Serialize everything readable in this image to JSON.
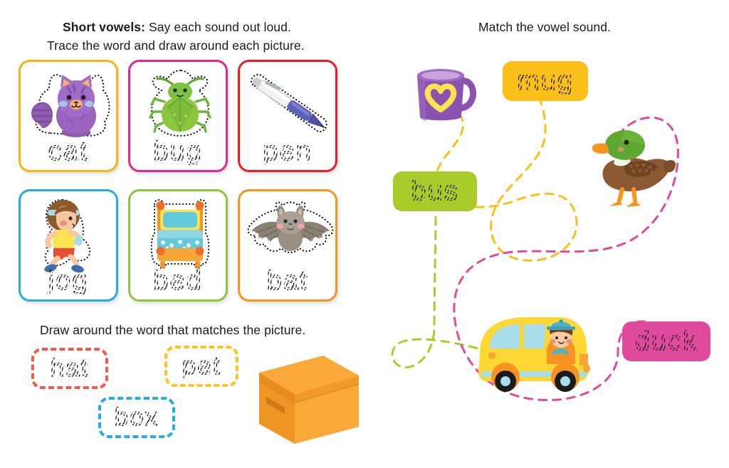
{
  "left": {
    "heading_bold": "Short vowels:",
    "heading_rest": " Say each sound out loud.",
    "heading_line2": "Trace the word and draw around each picture.",
    "cards": [
      {
        "word": "cat",
        "border": "#F5B513",
        "art": "cat-illustration"
      },
      {
        "word": "bug",
        "border": "#E5268F",
        "art": "bug-illustration"
      },
      {
        "word": "pen",
        "border": "#ED1C24",
        "art": "pen-illustration"
      },
      {
        "word": "jog",
        "border": "#29ABE2",
        "art": "jogger-illustration"
      },
      {
        "word": "bed",
        "border": "#8CC63F",
        "art": "bed-illustration"
      },
      {
        "word": "bat",
        "border": "#F7941E",
        "art": "bat-illustration"
      }
    ],
    "subheading": "Draw around the word that matches the picture.",
    "word_choices": [
      {
        "word": "hat",
        "border": "#F15A4A"
      },
      {
        "word": "pet",
        "border": "#FDC41F"
      },
      {
        "word": "box",
        "border": "#29ABE2"
      }
    ],
    "picture": "orange-box-illustration"
  },
  "right": {
    "heading": "Match the vowel sound.",
    "pictures": [
      {
        "name": "purple-mug-illustration",
        "label": "mug-picture"
      },
      {
        "name": "mallard-duck-illustration",
        "label": "duck-picture"
      },
      {
        "name": "yellow-school-bus-illustration",
        "label": "bus-picture"
      }
    ],
    "pills": [
      {
        "word": "mug",
        "fill": "#FBBF1A",
        "line": "#FBBF1A"
      },
      {
        "word": "bus",
        "fill": "#AACC2B",
        "line": "#AACC2B"
      },
      {
        "word": "duck",
        "fill": "#E04A9C",
        "line": "#E04A9C"
      }
    ],
    "path_colors": {
      "mug_path": "#FBBF1A",
      "bus_path": "#AACC2B",
      "duck_path": "#E04A9C"
    }
  }
}
